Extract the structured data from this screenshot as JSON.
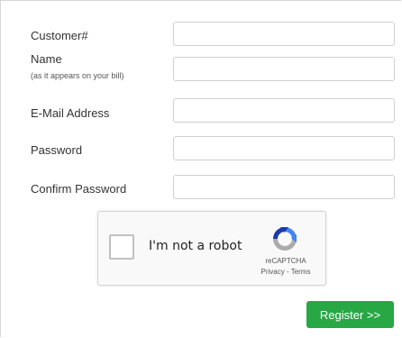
{
  "form": {
    "customer_label": "Customer#",
    "customer_value": "",
    "name_label": "Name",
    "name_sublabel": "(as it appears on your bill)",
    "name_value": "",
    "email_label": "E-Mail Address",
    "email_value": "",
    "password_label": "Password",
    "password_value": "",
    "confirm_label": "Confirm Password",
    "confirm_value": ""
  },
  "captcha": {
    "checkbox_label": "I'm not a robot",
    "brand": "reCAPTCHA",
    "privacy_link": "Privacy",
    "separator": " - ",
    "terms_link": "Terms",
    "logo_icon": "recaptcha-logo-icon",
    "logo_colors": [
      "#1c3aa9",
      "#4285f4",
      "#ababab"
    ]
  },
  "register_button": {
    "label": "Register >>",
    "color": "#28a745"
  }
}
